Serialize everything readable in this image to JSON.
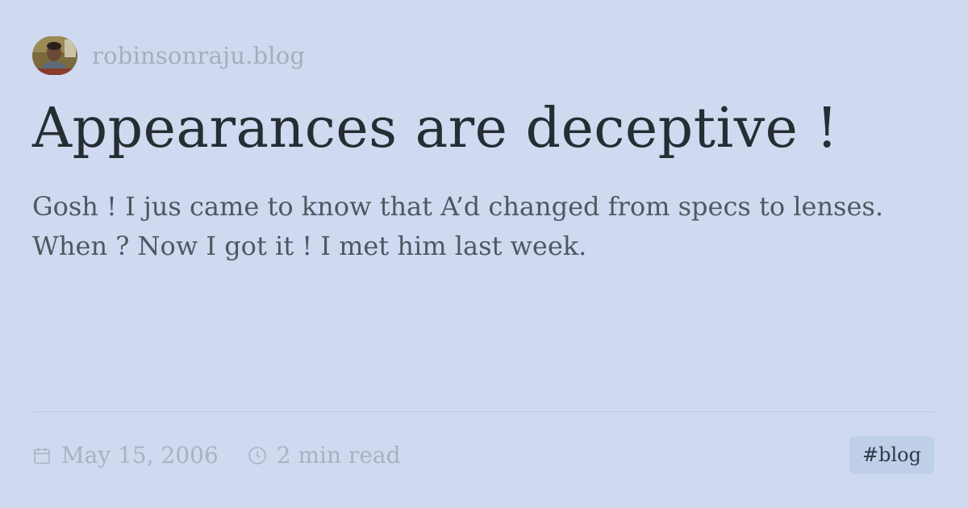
{
  "site": {
    "name": "robinsonraju.blog",
    "avatar_icon": "profile-photo"
  },
  "post": {
    "title": "Appearances are deceptive !",
    "excerpt": "Gosh ! I jus came to know that A’d changed from specs to lenses. When ? Now I got it ! I met him last week."
  },
  "meta": {
    "date": "May 15, 2006",
    "date_icon": "calendar-icon",
    "read_time": "2 min read",
    "read_time_icon": "clock-icon",
    "tag": "#blog"
  },
  "colors": {
    "background": "#cfdaf1",
    "title": "#262d33",
    "excerpt": "#4f5860",
    "muted": "#aab2bf",
    "tag_background": "#bfcfe8"
  }
}
